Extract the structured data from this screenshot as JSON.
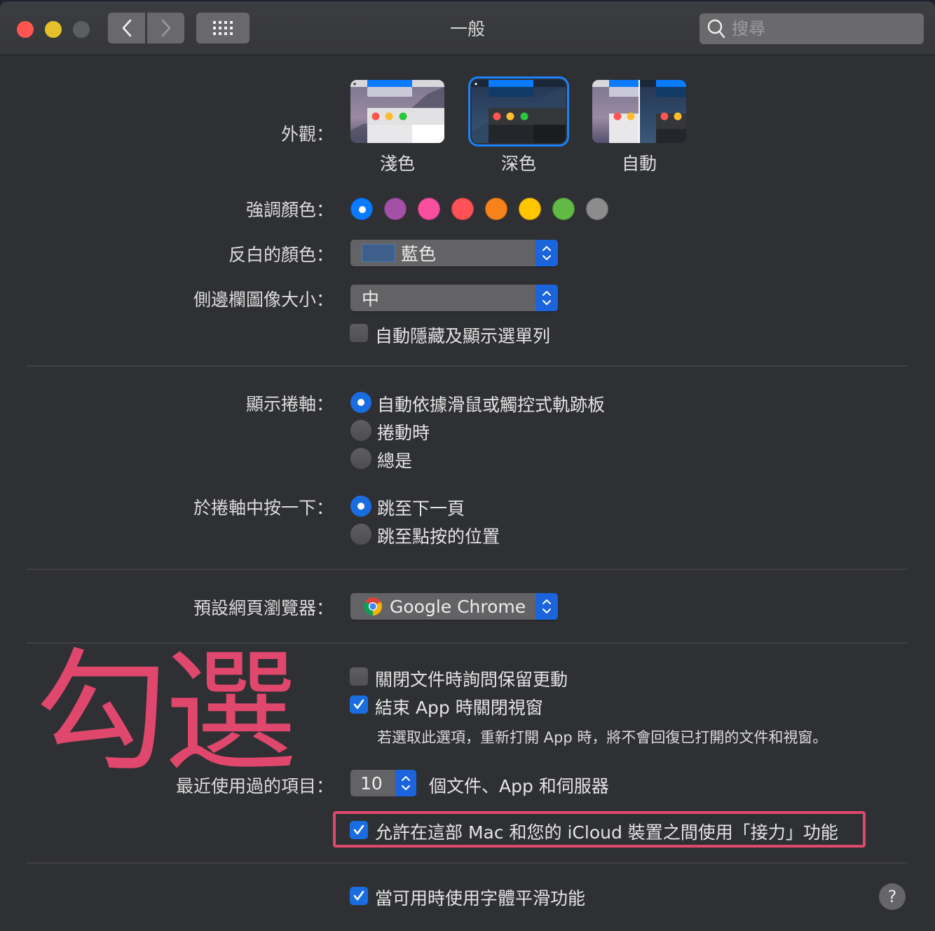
{
  "window": {
    "title": "一般",
    "search_placeholder": "搜尋"
  },
  "appearance": {
    "label": "外觀：",
    "options": [
      {
        "name": "淺色",
        "selected": false
      },
      {
        "name": "深色",
        "selected": true
      },
      {
        "name": "自動",
        "selected": false
      }
    ]
  },
  "accent": {
    "label": "強調顏色：",
    "colors": [
      "#0a7aff",
      "#a550a7",
      "#f74f9e",
      "#ff5257",
      "#f7821b",
      "#ffc600",
      "#62ba46",
      "#8c8c8c"
    ],
    "selected_index": 0
  },
  "highlight": {
    "label": "反白的顏色：",
    "value": "藍色",
    "swatch_color": "#3e5f8a"
  },
  "sidebar_icon": {
    "label": "側邊欄圖像大小：",
    "value": "中"
  },
  "menu_bar": {
    "label": "自動隱藏及顯示選單列",
    "checked": false
  },
  "scrollbars": {
    "label": "顯示捲軸：",
    "options": [
      {
        "label": "自動依據滑鼠或觸控式軌跡板",
        "selected": true
      },
      {
        "label": "捲動時",
        "selected": false
      },
      {
        "label": "總是",
        "selected": false
      }
    ]
  },
  "scroll_click": {
    "label": "於捲軸中按一下：",
    "options": [
      {
        "label": "跳至下一頁",
        "selected": true
      },
      {
        "label": "跳至點按的位置",
        "selected": false
      }
    ]
  },
  "browser": {
    "label": "預設網頁瀏覽器：",
    "value": "Google Chrome",
    "icon": "chrome-icon"
  },
  "documents": {
    "ask_keep_changes": {
      "label": "關閉文件時詢問保留更動",
      "checked": false
    },
    "close_windows": {
      "label": "結束 App 時關閉視窗",
      "checked": true
    },
    "note": "若選取此選項，重新打開 App 時，將不會回復已打開的文件和視窗。"
  },
  "recent_items": {
    "label": "最近使用過的項目：",
    "value": "10",
    "suffix": "個文件、App 和伺服器"
  },
  "handoff": {
    "label": "允許在這部 Mac 和您的 iCloud 裝置之間使用「接力」功能",
    "checked": true
  },
  "font_smoothing": {
    "label": "當可用時使用字體平滑功能",
    "checked": true
  },
  "annotation": {
    "text": "勾選",
    "color": "#e0476d"
  },
  "help_label": "?"
}
